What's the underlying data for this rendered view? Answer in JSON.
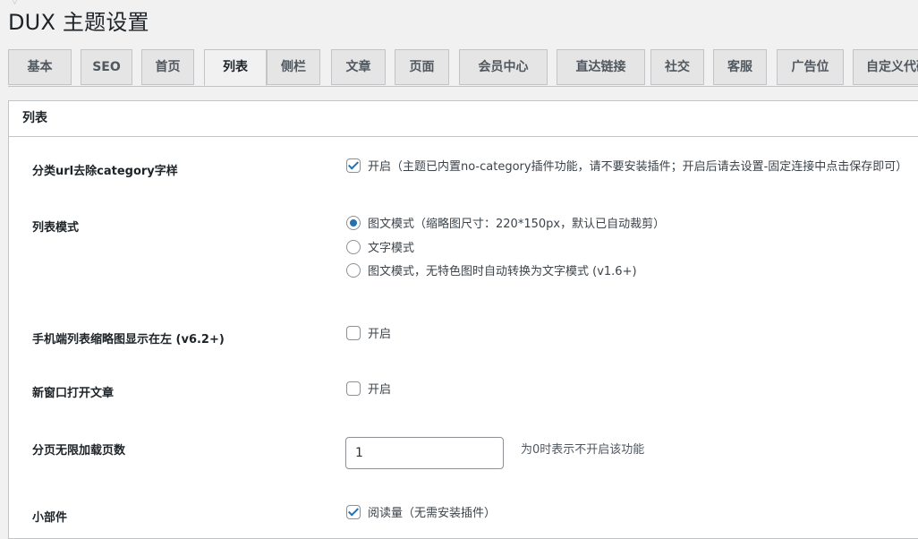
{
  "page": {
    "title": "DUX 主题设置"
  },
  "tabs": [
    {
      "label": "基本"
    },
    {
      "label": "SEO"
    },
    {
      "label": "首页"
    },
    {
      "label": "列表",
      "active": true
    },
    {
      "label": "侧栏"
    },
    {
      "label": "文章"
    },
    {
      "label": "页面"
    },
    {
      "label": "会员中心"
    },
    {
      "label": "直达链接"
    },
    {
      "label": "社交"
    },
    {
      "label": "客服"
    },
    {
      "label": "广告位"
    },
    {
      "label": "自定义代码"
    }
  ],
  "section": {
    "title": "列表"
  },
  "fields": {
    "category_base": {
      "label": "分类url去除category字样",
      "checked": true,
      "option": "开启（主题已内置no-category插件功能，请不要安装插件；开启后请去设置-固定连接中点击保存即可）"
    },
    "list_mode": {
      "label": "列表模式",
      "options": [
        {
          "text": "图文模式（缩略图尺寸：220*150px，默认已自动裁剪）",
          "checked": true
        },
        {
          "text": "文字模式",
          "checked": false
        },
        {
          "text": "图文模式，无特色图时自动转换为文字模式 (v1.6+)",
          "checked": false
        }
      ]
    },
    "mobile_thumb_left": {
      "label": "手机端列表缩略图显示在左 (v6.2+)",
      "checked": false,
      "option": "开启"
    },
    "new_window": {
      "label": "新窗口打开文章",
      "checked": false,
      "option": "开启"
    },
    "ajax_pages": {
      "label": "分页无限加载页数",
      "value": "1",
      "hint": "为0时表示不开启该功能"
    },
    "widgets": {
      "label": "小部件",
      "checked": true,
      "option": "阅读量（无需安装插件）"
    }
  }
}
